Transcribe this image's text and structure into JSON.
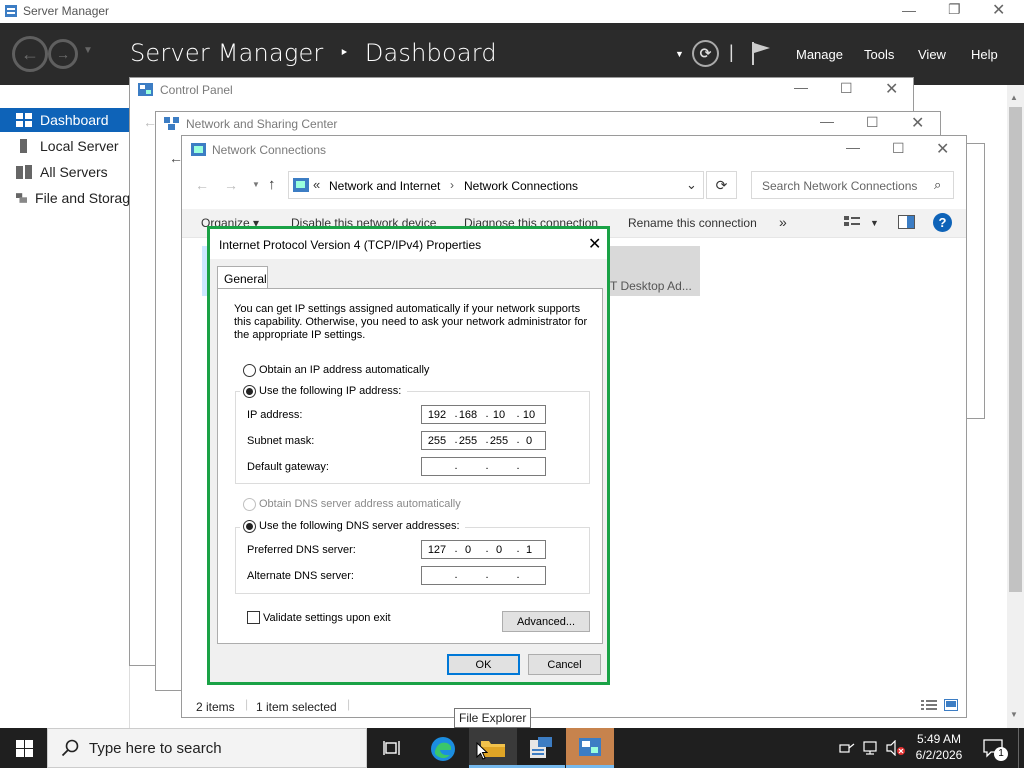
{
  "server_manager": {
    "window_title": "Server Manager",
    "breadcrumb": "Server Manager",
    "breadcrumb_sep": "‣",
    "page": "Dashboard",
    "menus": [
      "Manage",
      "Tools",
      "View",
      "Help"
    ],
    "nav": [
      "Dashboard",
      "Local Server",
      "All Servers",
      "File and Storag"
    ]
  },
  "control_panel": {
    "title": "Control Panel"
  },
  "network_sharing": {
    "title": "Network and Sharing Center"
  },
  "network_connections": {
    "title": "Network Connections",
    "address_prefix": "«",
    "address_parts": [
      "Network and Internet",
      "Network Connections"
    ],
    "search_placeholder": "Search Network Connections",
    "commands": [
      "Organize ▾",
      "Disable this network device",
      "Diagnose this connection",
      "Rename this connection",
      "»"
    ],
    "adapter_partial": "T Desktop Ad...",
    "status_items": "2 items",
    "status_selected": "1 item selected"
  },
  "dialog": {
    "title": "Internet Protocol Version 4 (TCP/IPv4) Properties",
    "tab": "General",
    "description": "You can get IP settings assigned automatically if your network supports this capability. Otherwise, you need to ask your network administrator for the appropriate IP settings.",
    "auto_ip": "Obtain an IP address automatically",
    "manual_ip": "Use the following IP address:",
    "ip_label": "IP address:",
    "ip": [
      "192",
      "168",
      "10",
      "10"
    ],
    "subnet_label": "Subnet mask:",
    "subnet": [
      "255",
      "255",
      "255",
      "0"
    ],
    "gateway_label": "Default gateway:",
    "gateway": [
      "",
      "",
      "",
      ""
    ],
    "auto_dns": "Obtain DNS server address automatically",
    "manual_dns": "Use the following DNS server addresses:",
    "pref_dns_label": "Preferred DNS server:",
    "pref_dns": [
      "127",
      "0",
      "0",
      "1"
    ],
    "alt_dns_label": "Alternate DNS server:",
    "alt_dns": [
      "",
      "",
      "",
      ""
    ],
    "validate": "Validate settings upon exit",
    "advanced": "Advanced...",
    "ok": "OK",
    "cancel": "Cancel"
  },
  "taskbar": {
    "search_placeholder": "Type here to search",
    "tooltip": "File Explorer",
    "time": "5:49 AM",
    "date": "6/2/2026",
    "notifications": "1"
  },
  "colors": {
    "accent": "#0e63b8",
    "highlight_frame": "#1aa246",
    "header_bg": "#2b2b2b"
  }
}
